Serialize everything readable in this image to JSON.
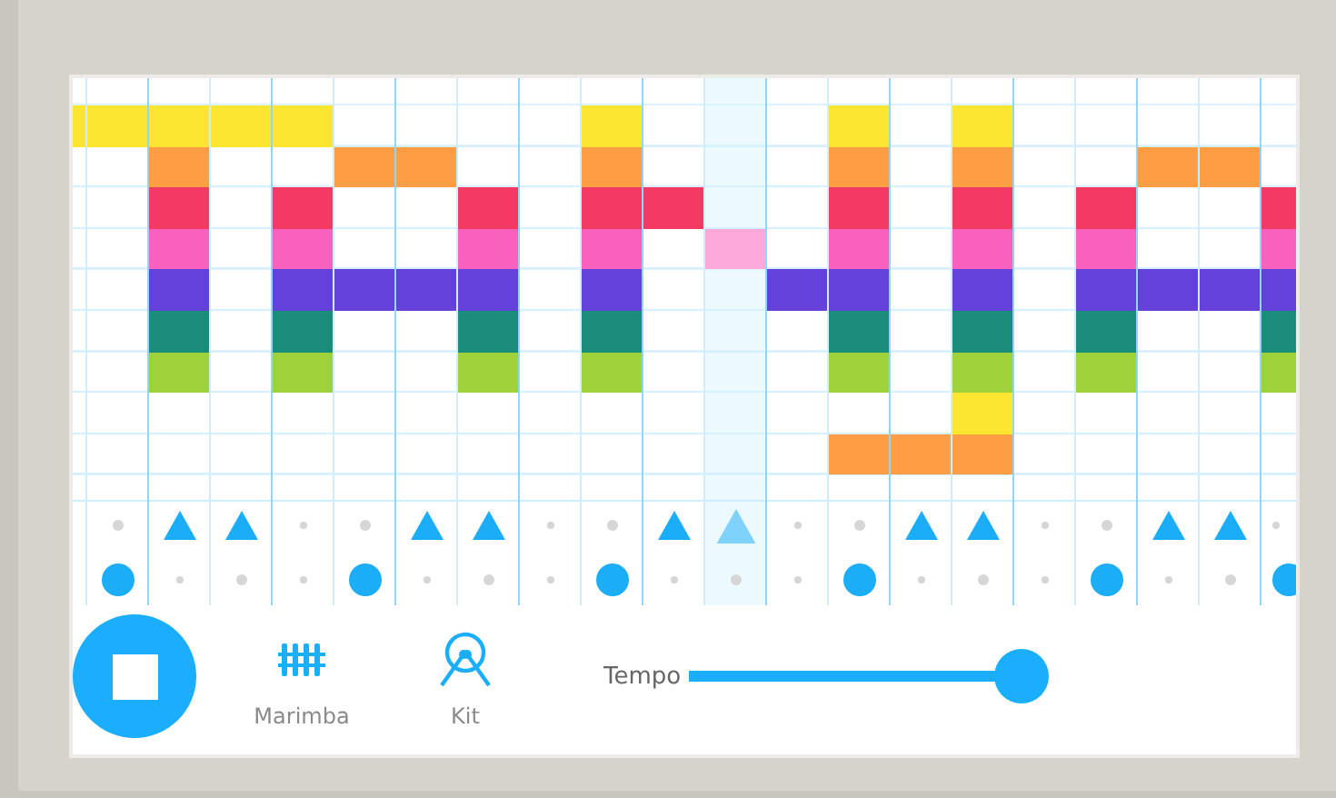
{
  "columns": [
    {
      "selected": false
    },
    {
      "selected": false
    },
    {
      "selected": false
    },
    {
      "selected": false
    },
    {
      "selected": false
    },
    {
      "selected": false
    },
    {
      "selected": false
    },
    {
      "selected": false
    },
    {
      "selected": false
    },
    {
      "selected": false
    },
    {
      "selected": false
    },
    {
      "selected": true
    },
    {
      "selected": false
    },
    {
      "selected": false
    },
    {
      "selected": false
    },
    {
      "selected": false
    },
    {
      "selected": false
    },
    {
      "selected": false
    },
    {
      "selected": false
    },
    {
      "selected": false
    },
    {
      "selected": false
    }
  ],
  "rows": [
    {
      "color": "#fde630",
      "on": [
        true,
        true,
        true,
        true,
        true,
        false,
        false,
        false,
        false,
        true,
        false,
        false,
        false,
        true,
        false,
        true,
        false,
        false,
        false,
        false,
        false
      ]
    },
    {
      "color": "#fd9e45",
      "on": [
        false,
        false,
        true,
        false,
        false,
        true,
        true,
        false,
        false,
        true,
        false,
        false,
        false,
        true,
        false,
        true,
        false,
        false,
        true,
        true,
        false
      ]
    },
    {
      "color": "#f43963",
      "on": [
        false,
        false,
        true,
        false,
        true,
        false,
        false,
        true,
        false,
        true,
        true,
        false,
        false,
        true,
        false,
        true,
        false,
        true,
        false,
        false,
        true
      ]
    },
    {
      "color": "#fa60be",
      "on": [
        false,
        false,
        true,
        false,
        true,
        false,
        false,
        true,
        false,
        true,
        false,
        true,
        false,
        true,
        false,
        true,
        false,
        true,
        false,
        false,
        true
      ]
    },
    {
      "color": "#6441d9",
      "on": [
        false,
        false,
        true,
        false,
        true,
        true,
        true,
        true,
        false,
        true,
        false,
        false,
        true,
        true,
        false,
        true,
        false,
        true,
        true,
        true,
        true
      ]
    },
    {
      "color": "#198c7a",
      "on": [
        false,
        false,
        true,
        false,
        true,
        false,
        false,
        true,
        false,
        true,
        false,
        false,
        false,
        true,
        false,
        true,
        false,
        true,
        false,
        false,
        true
      ]
    },
    {
      "color": "#9fd23a",
      "on": [
        false,
        false,
        true,
        false,
        true,
        false,
        false,
        true,
        false,
        true,
        false,
        false,
        false,
        true,
        false,
        true,
        false,
        true,
        false,
        false,
        true
      ]
    },
    {
      "color": "#fde630",
      "on": [
        false,
        false,
        false,
        false,
        false,
        false,
        false,
        false,
        false,
        false,
        false,
        false,
        false,
        false,
        false,
        true,
        false,
        false,
        false,
        false,
        false
      ]
    },
    {
      "color": "#fd9e45",
      "on": [
        false,
        false,
        false,
        false,
        false,
        false,
        false,
        false,
        false,
        false,
        false,
        false,
        false,
        true,
        true,
        true,
        false,
        false,
        false,
        false,
        false
      ]
    }
  ],
  "rhythm": [
    {
      "kind": "triangle",
      "steps": [
        false,
        true,
        true,
        false,
        false,
        true,
        true,
        false,
        false,
        true,
        true,
        false,
        false,
        true,
        true,
        false,
        false,
        true,
        true,
        false
      ]
    },
    {
      "kind": "circle",
      "steps": [
        true,
        false,
        false,
        false,
        true,
        false,
        false,
        false,
        true,
        false,
        false,
        false,
        true,
        false,
        false,
        false,
        true,
        false,
        false,
        true
      ]
    }
  ],
  "controls": {
    "playing": true,
    "instruments": [
      {
        "kind": "marimba",
        "label": "Marimba"
      },
      {
        "kind": "kit",
        "label": "Kit"
      }
    ],
    "tempo": {
      "label": "Tempo",
      "level": 1
    }
  }
}
